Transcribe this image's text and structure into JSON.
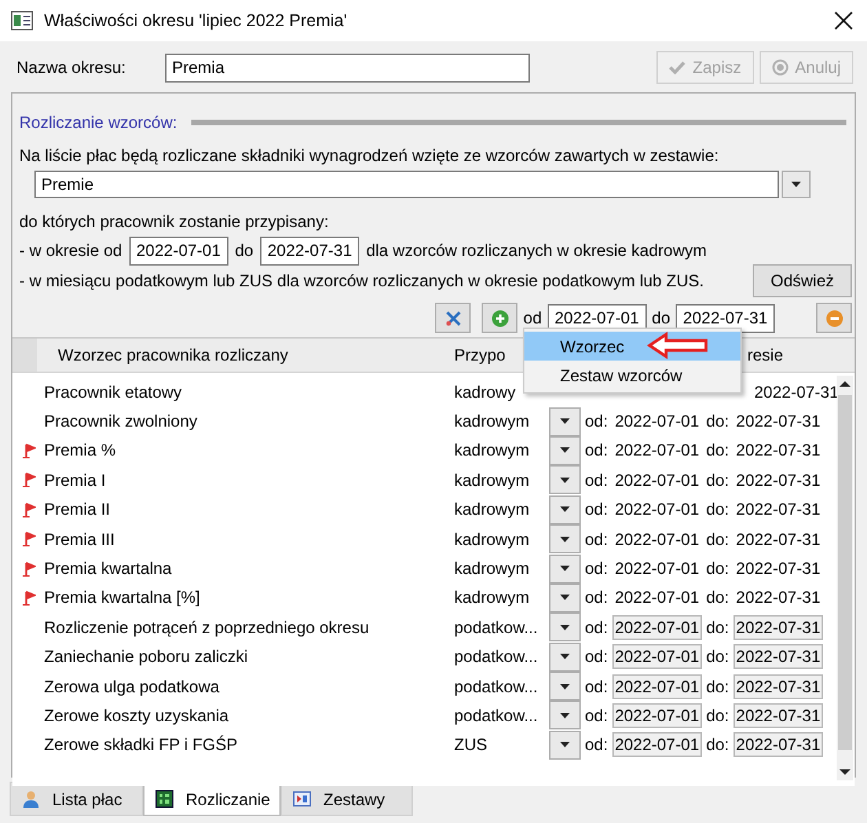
{
  "window": {
    "title": "Właściwości okresu 'lipiec 2022 Premia'"
  },
  "period_name": {
    "label": "Nazwa okresu:",
    "value": "Premia"
  },
  "buttons": [
    {
      "label": "Zapisz",
      "kind": "check",
      "disabled": true
    },
    {
      "label": "Anuluj",
      "kind": "cancel",
      "disabled": true
    }
  ],
  "section": {
    "title": "Rozliczanie wzorców:",
    "intro": "Na liście płac będą rozliczane składniki wynagrodzeń wzięte ze wzorców zawartych w zestawie:",
    "set": {
      "value": "Premie"
    },
    "assigned_label": "do których pracownik zostanie przypisany:",
    "period_line": {
      "prefix": "- w okresie od",
      "from": "2022-07-01",
      "to_label": "do",
      "to": "2022-07-31",
      "suffix": "dla wzorców rozliczanych w okresie kadrowym"
    },
    "tax_line": "- w miesiącu podatkowym lub ZUS dla wzorców rozliczanych w okresie podatkowym lub ZUS.",
    "refresh_button": "Odśwież"
  },
  "toolbar": {
    "from_label": "od",
    "from": "2022-07-01",
    "to_label": "do",
    "to": "2022-07-31"
  },
  "table": {
    "columns": [
      "Wzorzec pracownika rozliczany",
      "Przypo",
      "resie"
    ],
    "rows": [
      {
        "name": "Pracownik etatowy",
        "flagged": false,
        "period": "kadrowy",
        "dropdown": false,
        "kind": "text",
        "to": "2022-07-31"
      },
      {
        "name": "Pracownik zwolniony",
        "flagged": false,
        "period": "kadrowym",
        "dropdown": true,
        "kind": "text",
        "from_label": "od:",
        "from": "2022-07-01",
        "to_label": "do:",
        "to": "2022-07-31"
      },
      {
        "name": "Premia %",
        "flagged": true,
        "period": "kadrowym",
        "dropdown": true,
        "kind": "text",
        "from_label": "od:",
        "from": "2022-07-01",
        "to_label": "do:",
        "to": "2022-07-31"
      },
      {
        "name": "Premia I",
        "flagged": true,
        "period": "kadrowym",
        "dropdown": true,
        "kind": "text",
        "from_label": "od:",
        "from": "2022-07-01",
        "to_label": "do:",
        "to": "2022-07-31"
      },
      {
        "name": "Premia II",
        "flagged": true,
        "period": "kadrowym",
        "dropdown": true,
        "kind": "text",
        "from_label": "od:",
        "from": "2022-07-01",
        "to_label": "do:",
        "to": "2022-07-31"
      },
      {
        "name": "Premia III",
        "flagged": true,
        "period": "kadrowym",
        "dropdown": true,
        "kind": "text",
        "from_label": "od:",
        "from": "2022-07-01",
        "to_label": "do:",
        "to": "2022-07-31"
      },
      {
        "name": "Premia kwartalna",
        "flagged": true,
        "period": "kadrowym",
        "dropdown": true,
        "kind": "text",
        "from_label": "od:",
        "from": "2022-07-01",
        "to_label": "do:",
        "to": "2022-07-31"
      },
      {
        "name": "Premia kwartalna [%]",
        "flagged": true,
        "period": "kadrowym",
        "dropdown": true,
        "kind": "text",
        "from_label": "od:",
        "from": "2022-07-01",
        "to_label": "do:",
        "to": "2022-07-31"
      },
      {
        "name": "Rozliczenie potrąceń z poprzedniego okresu",
        "flagged": false,
        "period": "podatkow...",
        "dropdown": true,
        "kind": "field",
        "from_label": "od:",
        "from": "2022-07-01",
        "to_label": "do:",
        "to": "2022-07-31"
      },
      {
        "name": "Zaniechanie poboru zaliczki",
        "flagged": false,
        "period": "podatkow...",
        "dropdown": true,
        "kind": "field",
        "from_label": "od:",
        "from": "2022-07-01",
        "to_label": "do:",
        "to": "2022-07-31"
      },
      {
        "name": "Zerowa ulga podatkowa",
        "flagged": false,
        "period": "podatkow...",
        "dropdown": true,
        "kind": "field",
        "from_label": "od:",
        "from": "2022-07-01",
        "to_label": "do:",
        "to": "2022-07-31"
      },
      {
        "name": "Zerowe koszty uzyskania",
        "flagged": false,
        "period": "podatkow...",
        "dropdown": true,
        "kind": "field",
        "from_label": "od:",
        "from": "2022-07-01",
        "to_label": "do:",
        "to": "2022-07-31"
      },
      {
        "name": "Zerowe składki FP i FGŚP",
        "flagged": false,
        "period": "ZUS",
        "dropdown": true,
        "kind": "field",
        "from_label": "od:",
        "from": "2022-07-01",
        "to_label": "do:",
        "to": "2022-07-31"
      }
    ]
  },
  "menu": {
    "items": [
      {
        "label": "Wzorzec",
        "selected": true
      },
      {
        "label": "Zestaw wzorców",
        "selected": false
      }
    ]
  },
  "tabs": [
    {
      "label": "Lista płac",
      "kind": "person",
      "selected": false
    },
    {
      "label": "Rozliczanie",
      "kind": "grid",
      "selected": true
    },
    {
      "label": "Zestawy",
      "kind": "set",
      "selected": false
    }
  ]
}
